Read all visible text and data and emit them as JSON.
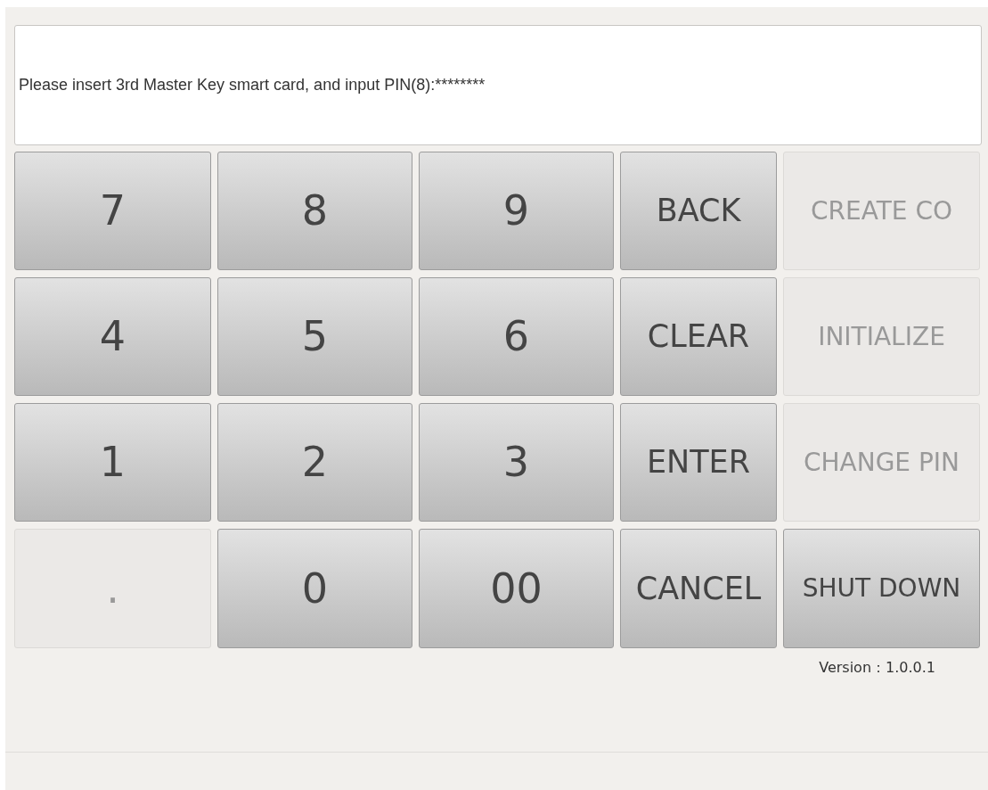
{
  "message": "Please insert 3rd Master Key smart card, and input PIN(8):********",
  "keys": [
    {
      "label": "7",
      "kind": "digit",
      "disabled": false
    },
    {
      "label": "8",
      "kind": "digit",
      "disabled": false
    },
    {
      "label": "9",
      "kind": "digit",
      "disabled": false
    },
    {
      "label": "BACK",
      "kind": "command",
      "disabled": false
    },
    {
      "label": "CREATE CO",
      "kind": "command",
      "disabled": true
    },
    {
      "label": "4",
      "kind": "digit",
      "disabled": false
    },
    {
      "label": "5",
      "kind": "digit",
      "disabled": false
    },
    {
      "label": "6",
      "kind": "digit",
      "disabled": false
    },
    {
      "label": "CLEAR",
      "kind": "command",
      "disabled": false
    },
    {
      "label": "INITIALIZE",
      "kind": "command",
      "disabled": true
    },
    {
      "label": "1",
      "kind": "digit",
      "disabled": false
    },
    {
      "label": "2",
      "kind": "digit",
      "disabled": false
    },
    {
      "label": "3",
      "kind": "digit",
      "disabled": false
    },
    {
      "label": "ENTER",
      "kind": "command",
      "disabled": false
    },
    {
      "label": "CHANGE PIN",
      "kind": "command",
      "disabled": true
    },
    {
      "label": ".",
      "kind": "digit",
      "disabled": true
    },
    {
      "label": "0",
      "kind": "digit",
      "disabled": false
    },
    {
      "label": "00",
      "kind": "digit",
      "disabled": false
    },
    {
      "label": "CANCEL",
      "kind": "command",
      "disabled": false
    },
    {
      "label": "SHUT DOWN",
      "kind": "command",
      "disabled": false
    }
  ],
  "version": "Version：1.0.0.1"
}
